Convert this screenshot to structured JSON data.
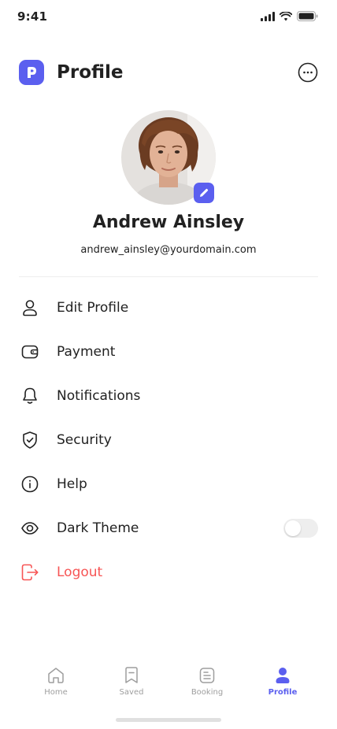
{
  "status_bar": {
    "time": "9:41"
  },
  "header": {
    "title": "Profile",
    "logo_letter": "P"
  },
  "profile": {
    "name": "Andrew Ainsley",
    "email": "andrew_ainsley@yourdomain.com"
  },
  "menu": {
    "items": [
      {
        "label": "Edit Profile",
        "icon": "user-icon"
      },
      {
        "label": "Payment",
        "icon": "wallet-icon"
      },
      {
        "label": "Notifications",
        "icon": "bell-icon"
      },
      {
        "label": "Security",
        "icon": "shield-check-icon"
      },
      {
        "label": "Help",
        "icon": "info-icon"
      },
      {
        "label": "Dark Theme",
        "icon": "eye-icon",
        "toggle": false
      },
      {
        "label": "Logout",
        "icon": "logout-icon",
        "danger": true
      }
    ]
  },
  "bottom_nav": {
    "items": [
      {
        "label": "Home",
        "icon": "home-icon",
        "active": false
      },
      {
        "label": "Saved",
        "icon": "bookmark-icon",
        "active": false
      },
      {
        "label": "Booking",
        "icon": "document-icon",
        "active": false
      },
      {
        "label": "Profile",
        "icon": "profile-icon",
        "active": true
      }
    ]
  },
  "colors": {
    "primary": "#5b5fef",
    "text": "#212121",
    "danger": "#f75555",
    "muted": "#9e9e9e"
  }
}
